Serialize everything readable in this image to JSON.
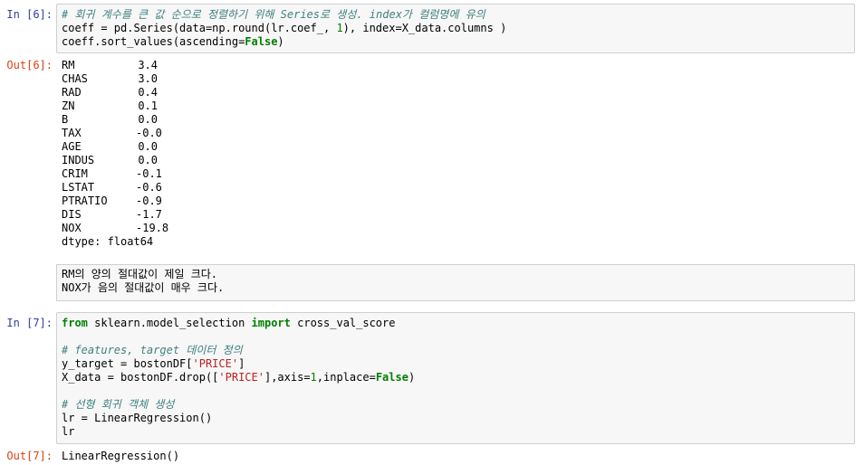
{
  "cell6": {
    "in_prompt": "In [6]:",
    "out_prompt": "Out[6]:",
    "code": {
      "line1": "# 회귀 계수를 큰 값 순으로 정렬하기 위해 Series로 생성. index가 컬럼명에 유의",
      "line2_a": "coeff = pd.Series(data=np.round(lr.coef_, ",
      "line2_num": "1",
      "line2_b": "), index=X_data.columns )",
      "line3_a": "coeff.sort_values(ascending=",
      "line3_kw": "False",
      "line3_b": ")"
    },
    "output": {
      "rows": [
        {
          "key": "RM",
          "value": "3.4"
        },
        {
          "key": "CHAS",
          "value": "3.0"
        },
        {
          "key": "RAD",
          "value": "0.4"
        },
        {
          "key": "ZN",
          "value": "0.1"
        },
        {
          "key": "B",
          "value": "0.0"
        },
        {
          "key": "TAX",
          "value": "-0.0"
        },
        {
          "key": "AGE",
          "value": "0.0"
        },
        {
          "key": "INDUS",
          "value": "0.0"
        },
        {
          "key": "CRIM",
          "value": "-0.1"
        },
        {
          "key": "LSTAT",
          "value": "-0.6"
        },
        {
          "key": "PTRATIO",
          "value": "-0.9"
        },
        {
          "key": "DIS",
          "value": "-1.7"
        },
        {
          "key": "NOX",
          "value": "-19.8"
        }
      ],
      "dtype": "dtype: float64"
    }
  },
  "markdown": {
    "line1": "RM의 양의 절대값이 제일 크다.",
    "line2": "NOX가 음의 절대값이 매우 크다."
  },
  "cell7": {
    "in_prompt": "In [7]:",
    "out_prompt": "Out[7]:",
    "code": {
      "l1_kw1": "from",
      "l1_mod": " sklearn.model_selection ",
      "l1_kw2": "import",
      "l1_rest": " cross_val_score",
      "l3": "# features, target 데이터 정의",
      "l4_a": "y_target = bostonDF[",
      "l4_str": "'PRICE'",
      "l4_b": "]",
      "l5_a": "X_data = bostonDF.drop([",
      "l5_str": "'PRICE'",
      "l5_b": "],axis=",
      "l5_num": "1",
      "l5_c": ",inplace=",
      "l5_kw": "False",
      "l5_d": ")",
      "l7": "# 선형 회귀 객체 생성",
      "l8": "lr = LinearRegression()",
      "l9": "lr"
    },
    "output": "LinearRegression()"
  }
}
